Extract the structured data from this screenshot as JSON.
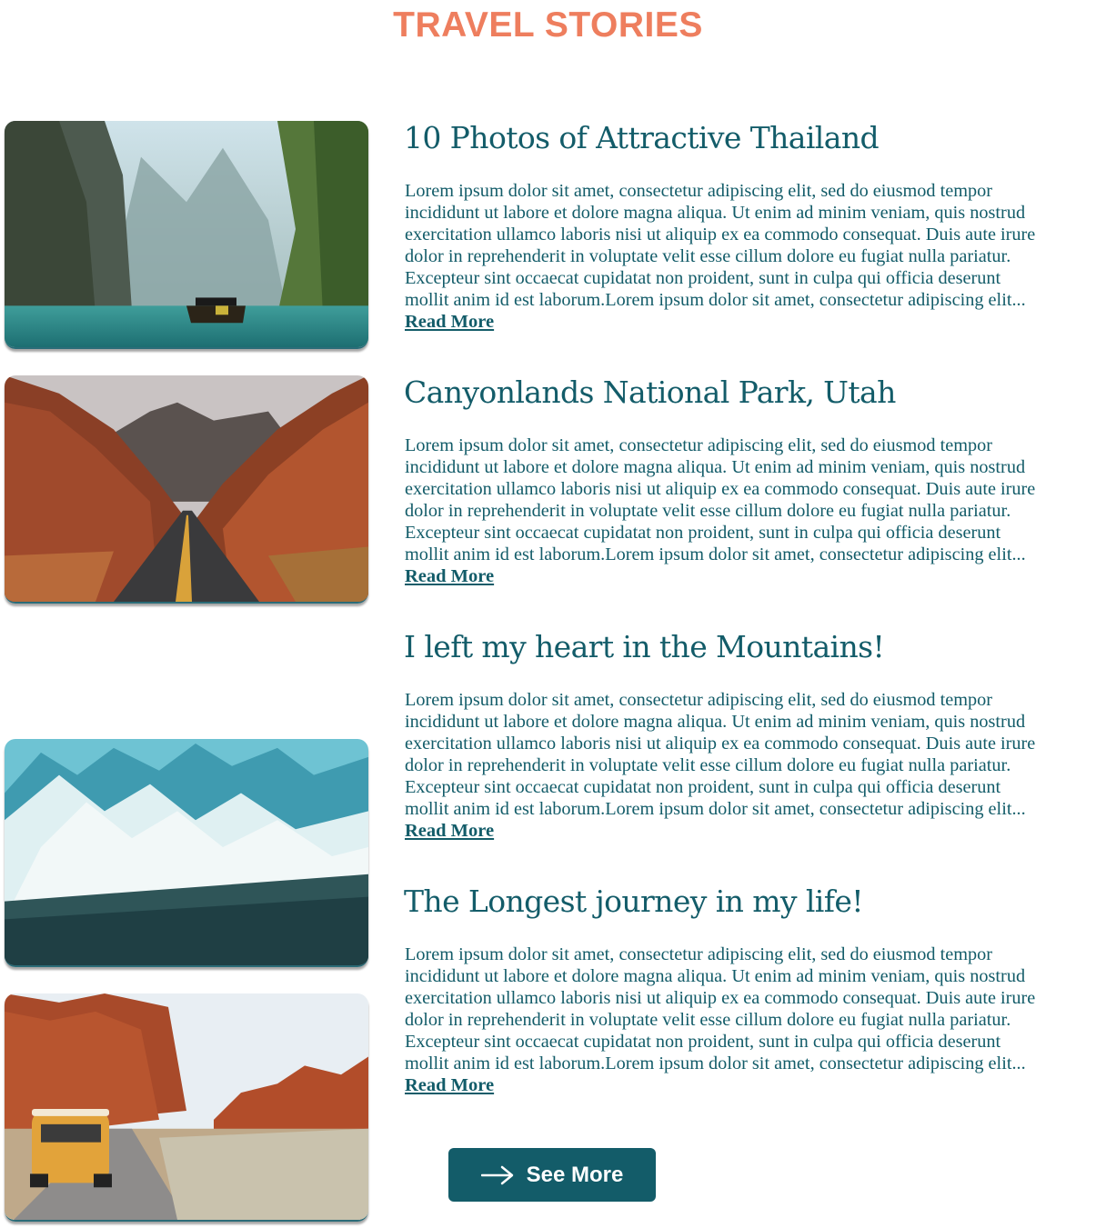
{
  "page": {
    "title": "TRAVEL STORIES",
    "see_more_label": "See More"
  },
  "colors": {
    "title_accent": "#ee7e5e",
    "brand_teal": "#135c69",
    "background": "#ffffff"
  },
  "stories": [
    {
      "title": "10 Photos of Attractive Thailand",
      "image": "thailand-lagoon-boat-photo",
      "body_lines": [
        "Lorem ipsum dolor sit amet, consectetur adipiscing elit, sed do eiusmod tempor",
        "incididunt ut labore et dolore magna aliqua. Ut enim ad minim veniam, quis nostrud",
        "exercitation ullamco laboris nisi ut aliquip ex ea commodo consequat. Duis aute irure",
        "dolor in reprehenderit in voluptate velit esse cillum dolore eu fugiat nulla pariatur.",
        "Excepteur sint occaecat cupidatat non proident, sunt in culpa qui officia deserunt",
        "mollit anim id est laborum.Lorem ipsum dolor sit amet, consectetur adipiscing elit..."
      ],
      "read_more": "Read More"
    },
    {
      "title": "Canyonlands National Park, Utah",
      "image": "canyon-road-photo",
      "body_lines": [
        "Lorem ipsum dolor sit amet, consectetur adipiscing elit, sed do eiusmod tempor",
        "incididunt ut labore et dolore magna aliqua. Ut enim ad minim veniam, quis nostrud",
        "exercitation ullamco laboris nisi ut aliquip ex ea commodo consequat. Duis aute irure",
        "dolor in reprehenderit in voluptate velit esse cillum dolore eu fugiat nulla pariatur.",
        "Excepteur sint occaecat cupidatat non proident, sunt in culpa qui officia deserunt",
        "mollit anim id est laborum.Lorem ipsum dolor sit amet, consectetur adipiscing elit..."
      ],
      "read_more": "Read More"
    },
    {
      "title": "I left my heart in the Mountains!",
      "image": "snowy-mountains-photo",
      "body_lines": [
        "Lorem ipsum dolor sit amet, consectetur adipiscing elit, sed do eiusmod tempor",
        "incididunt ut labore et dolore magna aliqua. Ut enim ad minim veniam, quis nostrud",
        "exercitation ullamco laboris nisi ut aliquip ex ea commodo consequat. Duis aute irure",
        "dolor in reprehenderit in voluptate velit esse cillum dolore eu fugiat nulla pariatur.",
        "Excepteur sint occaecat cupidatat non proident, sunt in culpa qui officia deserunt",
        "mollit anim id est laborum.Lorem ipsum dolor sit amet, consectetur adipiscing elit..."
      ],
      "read_more": "Read More"
    },
    {
      "title": "The Longest journey in my life!",
      "image": "desert-road-van-photo",
      "body_lines": [
        "Lorem ipsum dolor sit amet, consectetur adipiscing elit, sed do eiusmod tempor",
        "incididunt ut labore et dolore magna aliqua. Ut enim ad minim veniam, quis nostrud",
        "exercitation ullamco laboris nisi ut aliquip ex ea commodo consequat. Duis aute irure",
        "dolor in reprehenderit in voluptate velit esse cillum dolore eu fugiat nulla pariatur.",
        "Excepteur sint occaecat cupidatat non proident, sunt in culpa qui officia deserunt",
        "mollit anim id est laborum.Lorem ipsum dolor sit amet, consectetur adipiscing elit..."
      ],
      "read_more": "Read More"
    }
  ],
  "icons": {
    "see_more": "arrow-right-icon"
  }
}
